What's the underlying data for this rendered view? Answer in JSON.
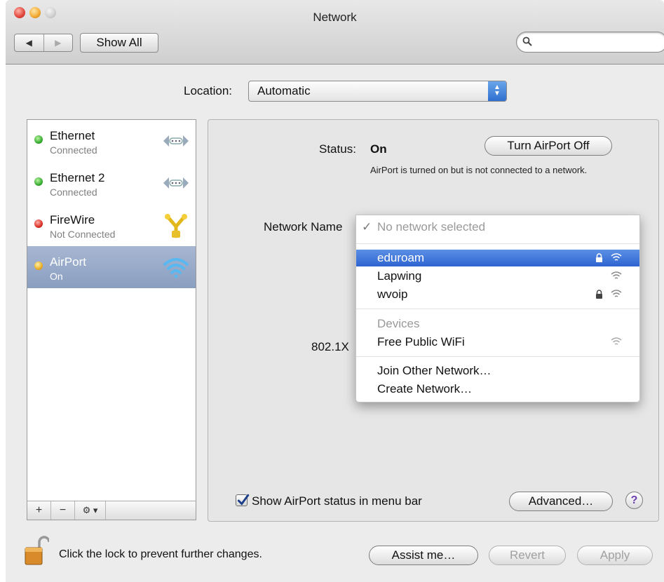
{
  "window": {
    "title": "Network"
  },
  "toolbar": {
    "back": "◀",
    "forward": "▶",
    "show_all": "Show All",
    "search_placeholder": ""
  },
  "location": {
    "label": "Location:",
    "value": "Automatic"
  },
  "services": [
    {
      "name": "Ethernet",
      "status": "Connected",
      "color": "#2fa72a",
      "icon": "ethernet-arrows-icon"
    },
    {
      "name": "Ethernet 2",
      "status": "Connected",
      "color": "#2fa72a",
      "icon": "ethernet-arrows-icon"
    },
    {
      "name": "FireWire",
      "status": "Not Connected",
      "color": "#d8261d",
      "icon": "firewire-icon"
    },
    {
      "name": "AirPort",
      "status": "On",
      "color": "#e8a81e",
      "icon": "wifi-icon"
    }
  ],
  "sidebar_buttons": {
    "add": "+",
    "remove": "−",
    "gear": "⚙ ▾"
  },
  "detail": {
    "status_label": "Status:",
    "status_value": "On",
    "toggle_button": "Turn AirPort Off",
    "status_description": "AirPort is turned on but is not connected to a network.",
    "network_name_label": "Network Name",
    "dot1x_label": "802.1X"
  },
  "network_menu": {
    "current": "No network selected",
    "check": "✓",
    "networks": [
      {
        "name": "eduroam",
        "locked": true
      },
      {
        "name": "Lapwing",
        "locked": false
      },
      {
        "name": "wvoip",
        "locked": true
      }
    ],
    "devices_header": "Devices",
    "devices": [
      {
        "name": "Free Public WiFi"
      }
    ],
    "join_other": "Join Other Network…",
    "create": "Create Network…"
  },
  "footer": {
    "show_status_label": "Show AirPort status in menu bar",
    "show_status_checked": true,
    "advanced": "Advanced…",
    "help": "?",
    "lock_text": "Click the lock to prevent further changes.",
    "assist": "Assist me…",
    "revert": "Revert",
    "apply": "Apply"
  },
  "colors": {
    "selection": "#2e64d0",
    "sidebar_selected": "#8a9ec0"
  }
}
